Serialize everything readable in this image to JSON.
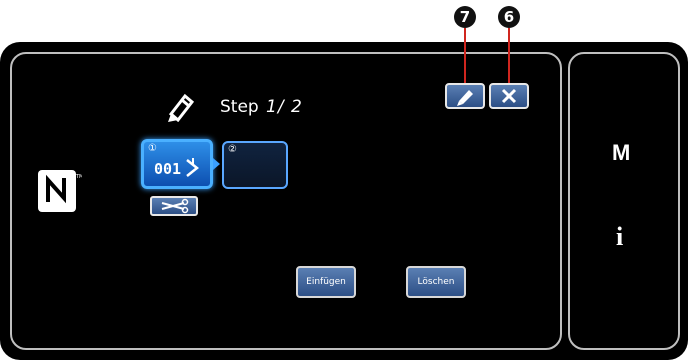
{
  "callouts": {
    "edit": "7",
    "close": "6"
  },
  "header": {
    "step_label": "Step",
    "step_count": "1/ 2"
  },
  "steps": [
    {
      "number": "①",
      "code": "001"
    },
    {
      "number": "②",
      "code": ""
    }
  ],
  "buttons": {
    "insert": "Einfügen",
    "delete": "Löschen"
  },
  "side": {
    "mode_label": "M",
    "info_label": "i"
  },
  "icons": {
    "edit": "pencil-icon",
    "close": "close-icon",
    "nfc": "nfc-icon",
    "tile_arrow": "step-arrow-icon",
    "scissors": "scissors-icon"
  },
  "colors": {
    "panel": "#000000",
    "button": "#3d639a",
    "active_tile": "#1e73d2",
    "callout_line": "#d0261f"
  }
}
